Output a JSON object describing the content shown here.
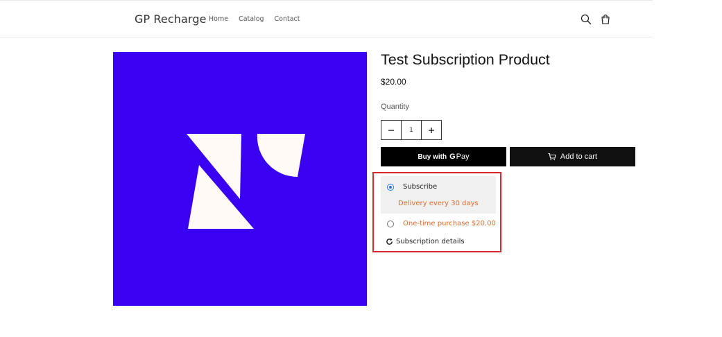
{
  "header": {
    "logo": "GP Recharge",
    "nav": [
      "Home",
      "Catalog",
      "Contact"
    ]
  },
  "product": {
    "title": "Test Subscription Product",
    "price": "$20.00",
    "quantity_label": "Quantity",
    "quantity_value": "1",
    "buy_with": "Buy with",
    "gpay_g": "G",
    "gpay_pay": "Pay",
    "add_to_cart": "Add to cart",
    "image_bg": "#3a00f2"
  },
  "subscription": {
    "subscribe_label": "Subscribe",
    "delivery": "Delivery every 30 days",
    "one_time": "One-time purchase $20.00",
    "details": "Subscription details"
  },
  "colors": {
    "accent_orange": "#e06a2b",
    "highlight_red": "#d9282f",
    "radio_blue": "#1a73e8"
  }
}
